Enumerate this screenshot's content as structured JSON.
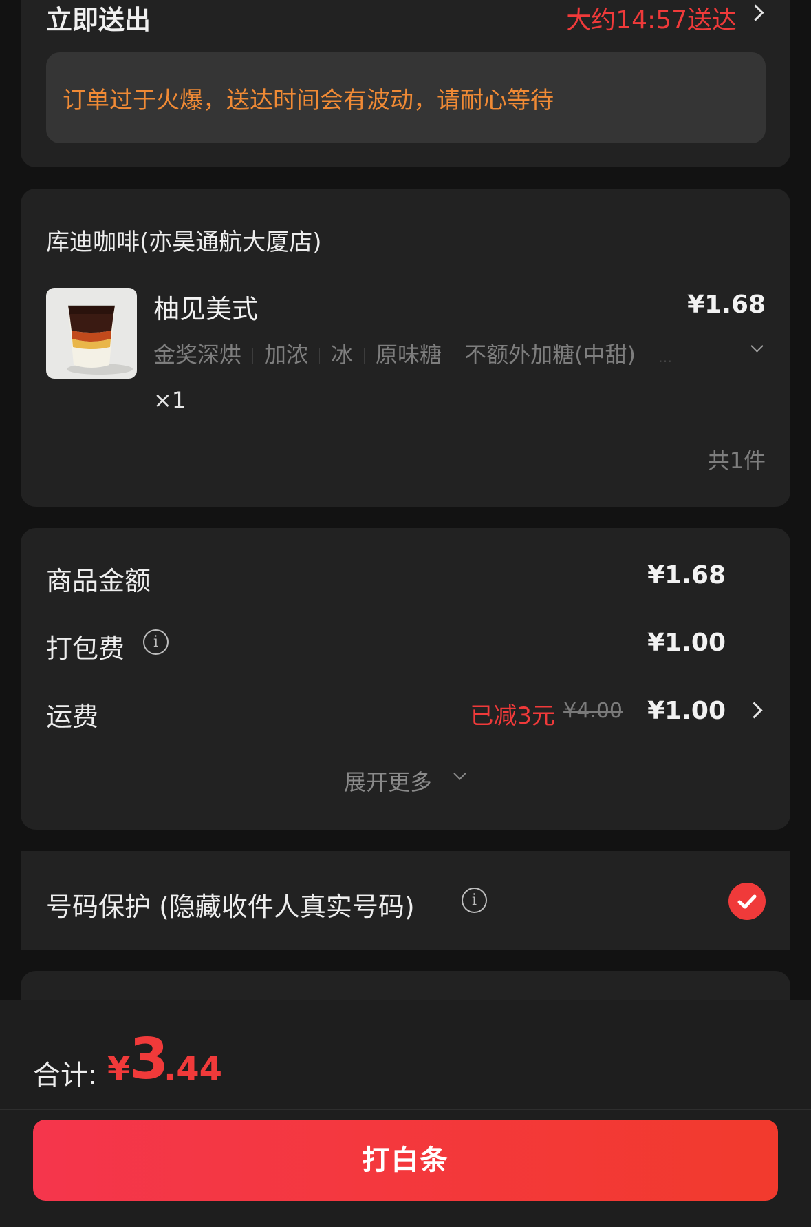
{
  "delivery": {
    "mode": "立即送出",
    "eta": "大约14:57送达",
    "notice": "订单过于火爆，送达时间会有波动，请耐心等待"
  },
  "store": {
    "name": "库迪咖啡(亦昊通航大厦店)",
    "item": {
      "name": "柚见美式",
      "price": "¥1.68",
      "specs": [
        "金奖深烘",
        "加浓",
        "冰",
        "原味糖",
        "不额外加糖(中甜)"
      ],
      "quantity": "×1"
    },
    "total_count": "共1件"
  },
  "fees": {
    "goods_label": "商品金额",
    "goods_value": "¥1.68",
    "packing_label": "打包费",
    "packing_value": "¥1.00",
    "shipping_label": "运费",
    "shipping_discount": "已减3元",
    "shipping_original": "¥4.00",
    "shipping_value": "¥1.00",
    "expand_label": "展开更多"
  },
  "privacy": {
    "label": "号码保护 (隐藏收件人真实号码)",
    "checked": true
  },
  "footer": {
    "total_label": "合计:",
    "currency": "¥",
    "total_int": "3",
    "total_dec": ".44",
    "pay_button": "打白条"
  },
  "colors": {
    "accent_red": "#f03a3a",
    "notice_orange": "#f08a35",
    "card_bg": "#222222",
    "page_bg": "#121212"
  }
}
